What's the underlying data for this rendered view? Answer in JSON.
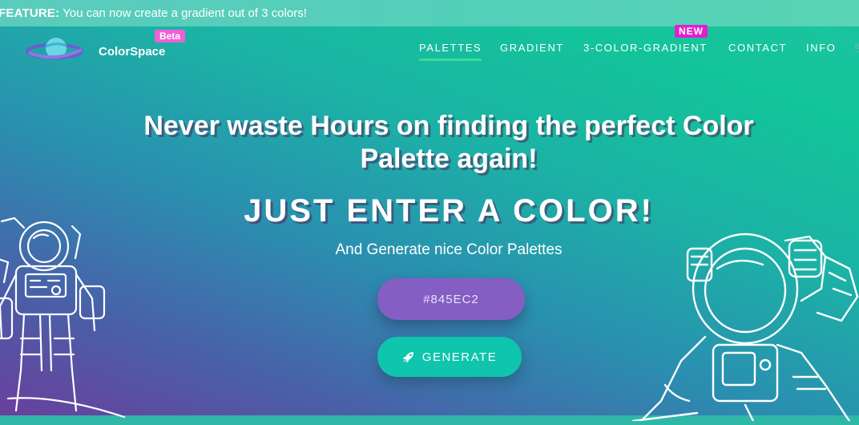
{
  "announcement": {
    "prefix": "FEATURE:",
    "text": " You can now create a gradient out of 3 colors!"
  },
  "logo": {
    "brand": "ColorSpace",
    "badge": "Beta"
  },
  "nav": {
    "items": [
      {
        "label": "PALETTES"
      },
      {
        "label": "GRADIENT"
      },
      {
        "label": "3-COLOR-GRADIENT"
      },
      {
        "label": "CONTACT"
      },
      {
        "label": "INFO"
      }
    ],
    "new_badge": "NEW"
  },
  "hero": {
    "title_line1": "Never waste Hours on finding the perfect Color",
    "title_line2": "Palette again!",
    "headline": "JUST ENTER A COLOR!",
    "subtitle": "And Generate nice Color Palettes",
    "color_input_value": "#845EC2",
    "generate_label": "GENERATE"
  },
  "colors": {
    "accent_purple": "#845EC2",
    "accent_teal": "#0FC5AD",
    "badge_pink": "#F05FD6",
    "new_magenta": "#E31FD0",
    "nav_underline": "#3DDC97"
  },
  "icons": {
    "generate": "rocket-icon",
    "logo": "planet-icon"
  }
}
